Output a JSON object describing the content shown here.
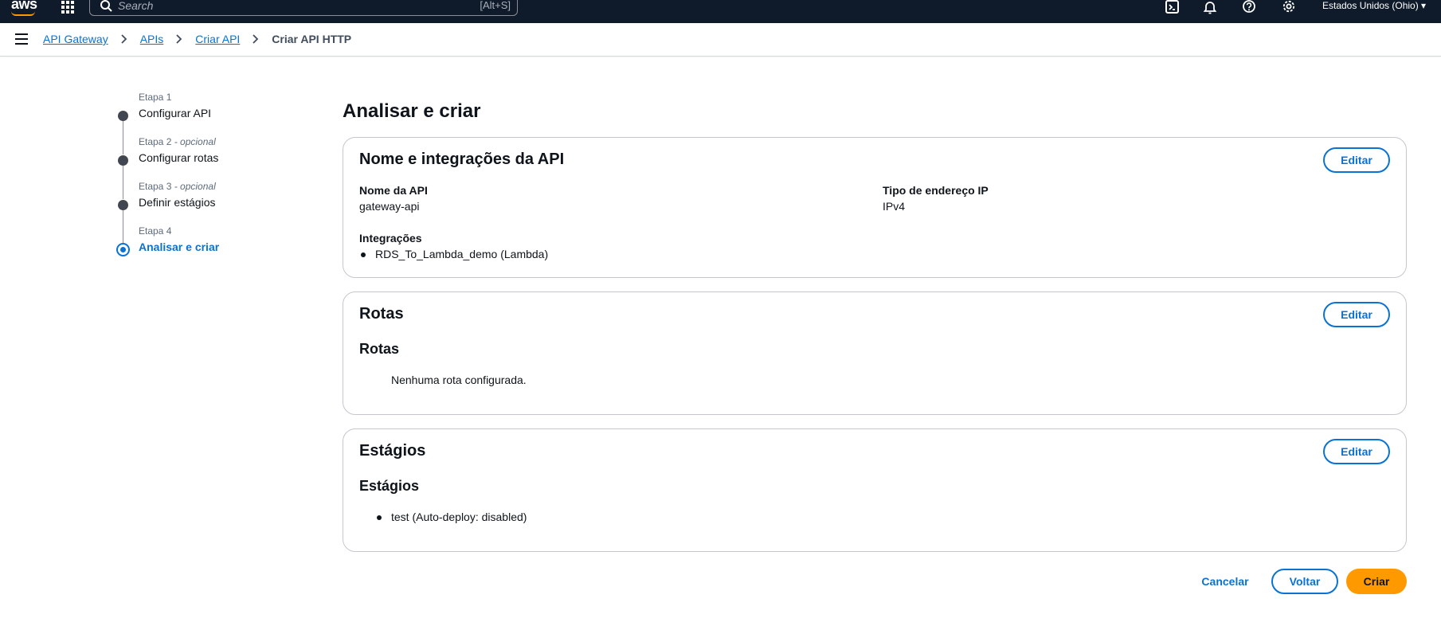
{
  "topnav": {
    "logo_text": "aws",
    "search": {
      "placeholder": "Search",
      "shortcut": "[Alt+S]"
    },
    "icons": [
      "cloudshell-icon",
      "bell-icon",
      "help-icon",
      "settings-icon"
    ],
    "region": "Estados Unidos (Ohio) ▾"
  },
  "breadcrumbs": {
    "items": [
      "API Gateway",
      "APIs",
      "Criar API"
    ],
    "current": "Criar API HTTP"
  },
  "steps": [
    {
      "kicker": "Etapa 1",
      "optional": "",
      "title": "Configurar API",
      "active": false
    },
    {
      "kicker": "Etapa 2",
      "optional": " - opcional",
      "title": "Configurar rotas",
      "active": false
    },
    {
      "kicker": "Etapa 3",
      "optional": " - opcional",
      "title": "Definir estágios",
      "active": false
    },
    {
      "kicker": "Etapa 4",
      "optional": "",
      "title": "Analisar e criar",
      "active": true
    }
  ],
  "main": {
    "title": "Analisar e criar",
    "api_card": {
      "header": "Nome e integrações da API",
      "edit_label": "Editar",
      "api_name_label": "Nome da API",
      "api_name_value": "gateway-api",
      "ip_type_label": "Tipo de endereço IP",
      "ip_type_value": "IPv4",
      "integrations_label": "Integrações",
      "integrations": [
        "RDS_To_Lambda_demo (Lambda)"
      ]
    },
    "routes_card": {
      "header": "Rotas",
      "edit_label": "Editar",
      "sub_heading": "Rotas",
      "empty_text": "Nenhuma rota configurada."
    },
    "stages_card": {
      "header": "Estágios",
      "edit_label": "Editar",
      "sub_heading": "Estágios",
      "stages": [
        "test (Auto-deploy: disabled)"
      ]
    }
  },
  "actions": {
    "cancel": "Cancelar",
    "back": "Voltar",
    "create": "Criar"
  },
  "colors": {
    "nav_bg": "#0f1b2a",
    "link_blue": "#0972d3",
    "primary_orange": "#ff9900",
    "text_dark": "#0f141a"
  }
}
